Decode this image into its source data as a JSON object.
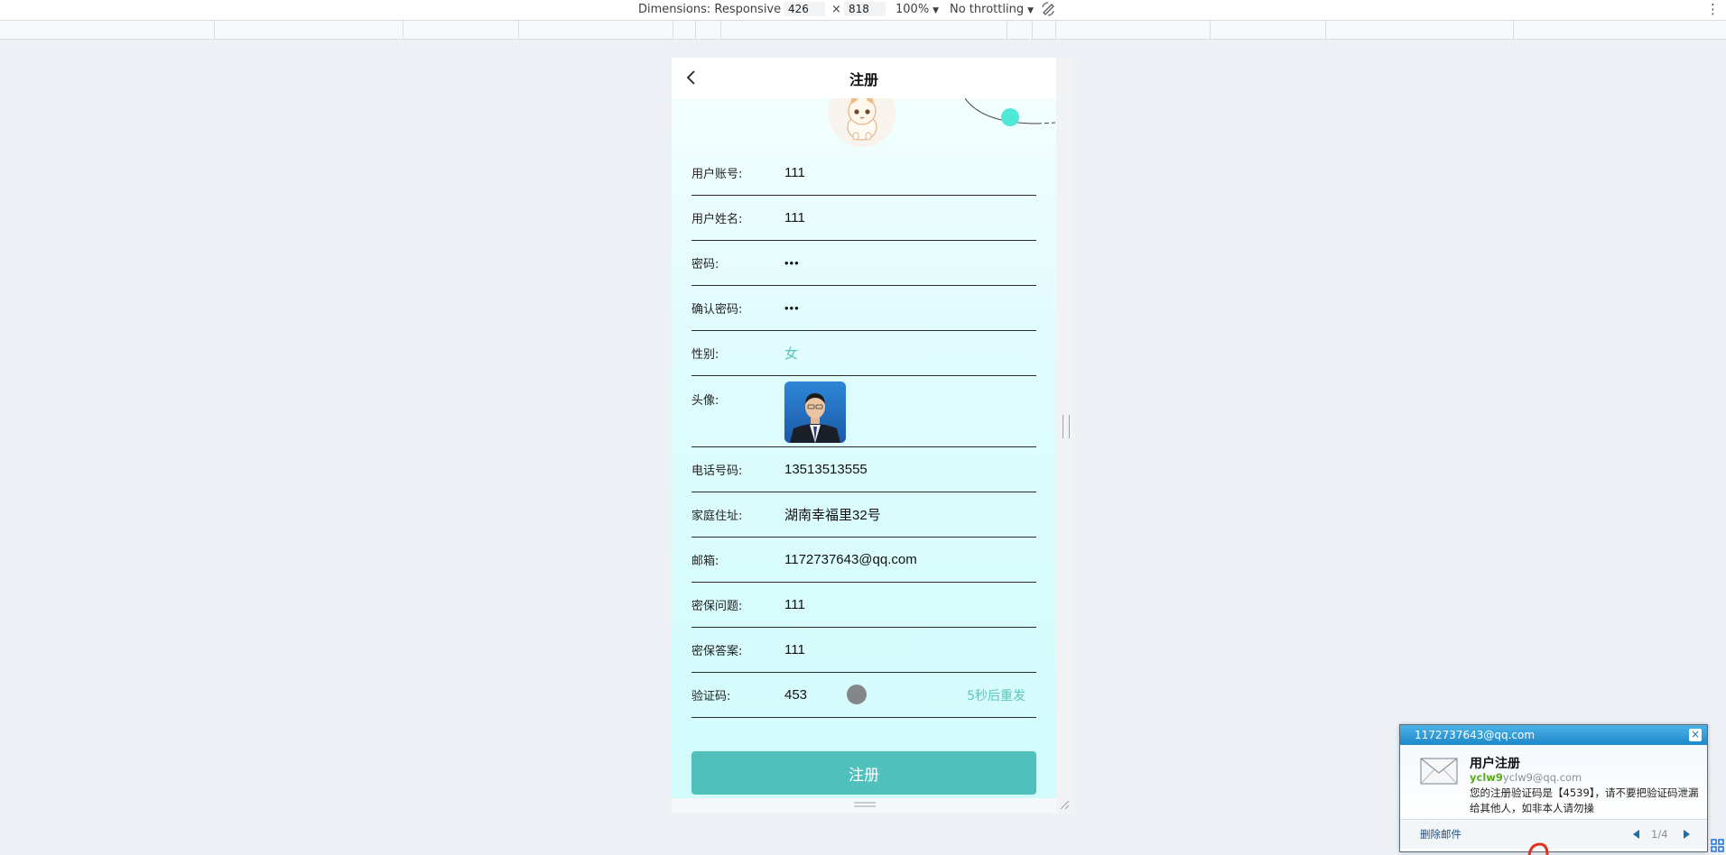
{
  "devtools": {
    "dimensions_label": "Dimensions: Responsive",
    "width": "426",
    "times": "×",
    "height": "818",
    "zoom": "100%",
    "throttling": "No throttling",
    "more": "⋮"
  },
  "app": {
    "title": "注册",
    "form": {
      "account": {
        "label": "用户账号:",
        "value": "111"
      },
      "name": {
        "label": "用户姓名:",
        "value": "111"
      },
      "password": {
        "label": "密码:",
        "value": "•••"
      },
      "confirm_password": {
        "label": "确认密码:",
        "value": "•••"
      },
      "gender": {
        "label": "性别:",
        "value": "女"
      },
      "avatar": {
        "label": "头像:"
      },
      "phone": {
        "label": "电话号码:",
        "value": "13513513555"
      },
      "address": {
        "label": "家庭住址:",
        "value": "湖南幸福里32号"
      },
      "email": {
        "label": "邮箱:",
        "value": "1172737643@qq.com"
      },
      "security_question": {
        "label": "密保问题:",
        "value": "111"
      },
      "security_answer": {
        "label": "密保答案:",
        "value": "111"
      },
      "code": {
        "label": "验证码:",
        "value": "453",
        "resend": "5秒后重发"
      }
    },
    "submit_label": "注册"
  },
  "mail_notification": {
    "account": "1172737643@qq.com",
    "close": "×",
    "subject": "用户注册",
    "sender_nick": "yclw9",
    "sender_addr": "yclw9@qq.com",
    "body": "您的注册验证码是【4539】，请不要把验证码泄漏给其他人，如非本人请勿操",
    "delete_label": "删除邮件",
    "page": "1/4"
  },
  "colors": {
    "accent": "#4fc0bb",
    "resend_text": "#5dc7c0",
    "content_bg_top": "#f2fefe",
    "content_bg_bottom": "#d2fbfb",
    "mail_header": "#1e88c9"
  },
  "icons": [
    "back-icon",
    "rotate-icon",
    "more-icon",
    "envelope-icon",
    "close-icon",
    "prev-icon",
    "next-icon"
  ]
}
